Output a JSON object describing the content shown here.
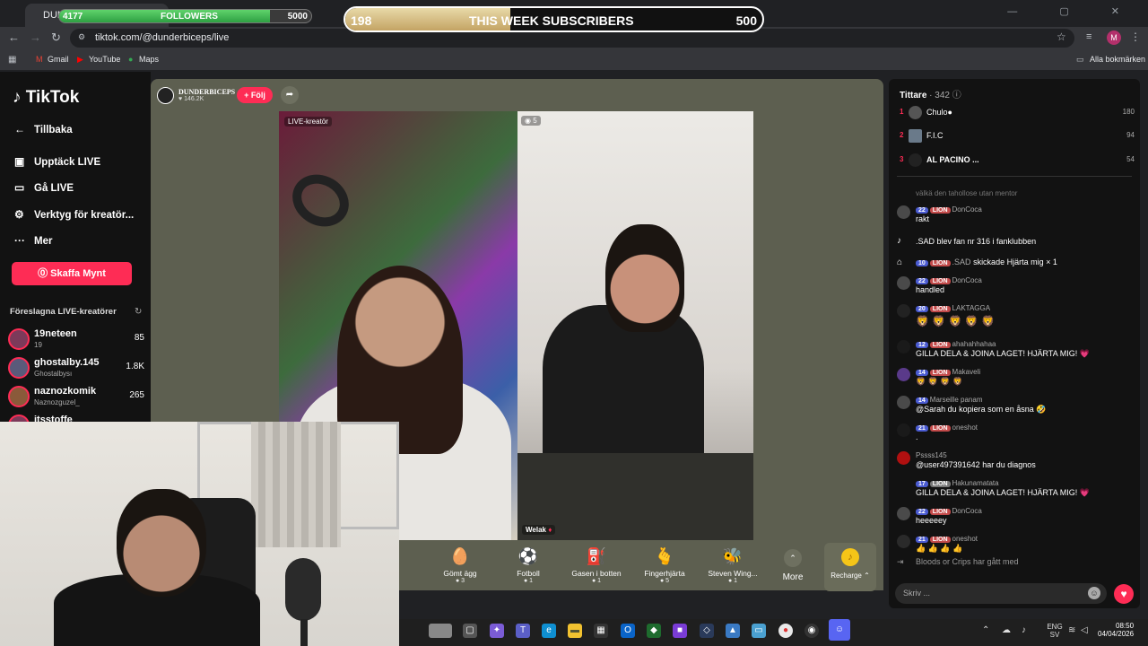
{
  "browser": {
    "tab_title": "DUND",
    "url": "tiktok.com/@dunderbiceps/live",
    "profile_initial": "M",
    "bookmarks": [
      "Gmail",
      "YouTube",
      "Maps"
    ],
    "all_bookmarks": "Alla bokmärken"
  },
  "overlay": {
    "followers": {
      "current": "4177",
      "label": "FOLLOWERS",
      "goal": "5000",
      "progress": 0.835
    },
    "subscribers": {
      "current": "198",
      "label": "THIS WEEK SUBSCRIBERS",
      "goal": "500",
      "progress": 0.396
    }
  },
  "sidebar": {
    "logo": "TikTok",
    "back": "Tillbaka",
    "items": [
      {
        "label": "Upptäck LIVE",
        "icon": "calendar-live-icon"
      },
      {
        "label": "Gå LIVE",
        "icon": "video-camera-icon"
      },
      {
        "label": "Verktyg för kreatör...",
        "icon": "tools-icon"
      },
      {
        "label": "Mer",
        "icon": "more-dots-icon"
      }
    ],
    "buy_coins": "Skaffa Mynt",
    "suggested_title": "Föreslagna LIVE-kreatörer",
    "creators": [
      {
        "name": "19neteen",
        "sub": "19",
        "count": "85"
      },
      {
        "name": "ghostalby.145",
        "sub": "Ghostalbysı",
        "count": "1.8K"
      },
      {
        "name": "naznozkomik",
        "sub": "Naznozguzel_",
        "count": "265"
      },
      {
        "name": "itsstoffe",
        "sub": "",
        "count": ""
      }
    ]
  },
  "stream": {
    "host_name": "DUNDERBICEPS",
    "host_likes": "146.2K",
    "follow": "+ Följ",
    "left_label": "LIVE-kreatör",
    "right_viewers": "5",
    "right_name": "Welak",
    "gifts": [
      {
        "name": "Gömt ägg",
        "cost": "3",
        "icon": "egg-icon"
      },
      {
        "name": "Fotboll",
        "cost": "1",
        "icon": "football-icon"
      },
      {
        "name": "Gasen i botten",
        "cost": "1",
        "icon": "gas-pedal-icon"
      },
      {
        "name": "Fingerhjärta",
        "cost": "5",
        "icon": "finger-heart-icon"
      },
      {
        "name": "Steven Wing...",
        "cost": "1",
        "icon": "bee-icon"
      }
    ],
    "more": "More",
    "recharge": "Recharge"
  },
  "chat": {
    "viewers_title": "Tittare",
    "viewers_count": "342",
    "top_viewers": [
      {
        "rank": "1",
        "name": "Chulo●",
        "score": "180"
      },
      {
        "rank": "2",
        "name": "F.I.C",
        "score": "94"
      },
      {
        "rank": "3",
        "name": "AL PACINO ...",
        "score": "54"
      }
    ],
    "faded_line": "välkä den tahollose utan mentor",
    "messages": [
      {
        "level": "22",
        "team": "LION",
        "user": "DonCoca",
        "text": "rakt"
      },
      {
        "level": "",
        "team": "",
        "user": "",
        "text": ".SAD blev fan nr 316 i fanklubben"
      },
      {
        "level": "10",
        "team": "LION",
        "user": ".SAD",
        "text": "skickade Hjärta mig × 1"
      },
      {
        "level": "22",
        "team": "LION",
        "user": "DonCoca",
        "text": "handled"
      },
      {
        "level": "20",
        "team": "LION",
        "user": "LAKTAGGA",
        "text": ""
      },
      {
        "level": "12",
        "team": "LION",
        "user": "ahahahhahaa",
        "text": "GILLA DELA & JOINA LAGET! HJÄRTA MIG! 💗"
      },
      {
        "level": "14",
        "team": "LION",
        "user": "Makaveli",
        "text": "🦁 🦁 🦁 🦁"
      },
      {
        "level": "14",
        "team": "",
        "user": "Marseille panam",
        "text": "@Sarah du kopiera som en åsna 🤣"
      },
      {
        "level": "21",
        "team": "LION",
        "user": "oneshot",
        "text": "."
      },
      {
        "level": "",
        "team": "",
        "user": "Pssss145",
        "text": "@user497391642 har du diagnos"
      },
      {
        "level": "17",
        "team": "LION",
        "user": "Hakunamatata",
        "text": "GILLA DELA & JOINA LAGET! HJÄRTA MIG! 💗"
      },
      {
        "level": "22",
        "team": "LION",
        "user": "DonCoca",
        "text": "heeeeey"
      },
      {
        "level": "21",
        "team": "LION",
        "user": "oneshot",
        "text": "👍 👍 👍 👍"
      }
    ],
    "last_line": "Bloods or Crips har gått med",
    "input_placeholder": "Skriv ..."
  },
  "taskbar": {
    "lang1": "ENG",
    "lang2": "SV",
    "time": "08:50",
    "date": "04/04/2026"
  }
}
